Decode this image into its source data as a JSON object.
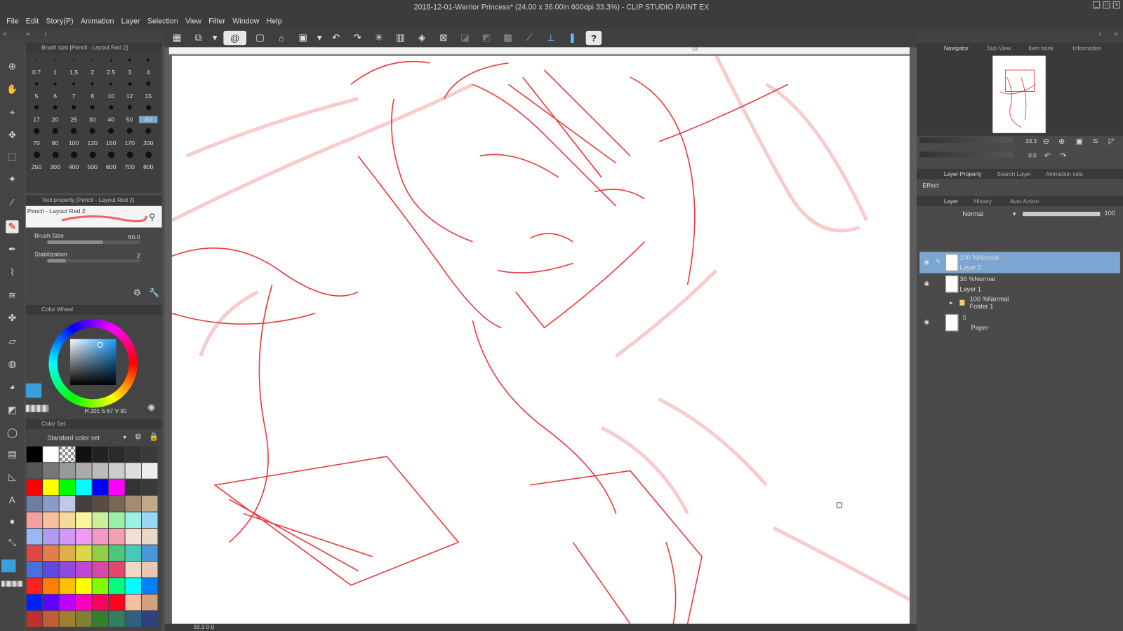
{
  "window": {
    "title": "2018-12-01-Warrior Princess* (24.00 x 36.00in 600dpi 33.3%) - CLIP STUDIO PAINT EX"
  },
  "menu": [
    "File",
    "Edit",
    "Story(P)",
    "Animation",
    "Layer",
    "Selection",
    "View",
    "Filter",
    "Window",
    "Help"
  ],
  "toolbar": {
    "icons": [
      "grid-icon",
      "sub-view-icon",
      "lasso-icon",
      "new-icon",
      "open-icon",
      "save-icon",
      "undo-icon",
      "redo-icon",
      "transform-icon",
      "help-icon"
    ]
  },
  "brush_panel": {
    "title": "Brush size [Pencil - Layout Red 2]",
    "sizes": [
      "0.7",
      "1",
      "1.5",
      "2",
      "2.5",
      "3",
      "4",
      "5",
      "6",
      "7",
      "8",
      "10",
      "12",
      "15",
      "17",
      "20",
      "25",
      "30",
      "40",
      "50",
      "60",
      "70",
      "80",
      "100",
      "120",
      "150",
      "170",
      "200",
      "250",
      "300",
      "400",
      "500",
      "600",
      "700",
      "800"
    ],
    "selected_size": "60"
  },
  "tool_property": {
    "title": "Tool property [Pencil - Layout Red 2]",
    "preset": "Pencil - Layout Red 2",
    "brush_size_label": "Brush Size",
    "brush_size_value": "60.0",
    "brush_size_level": 0.6,
    "stabilization_label": "Stabilization",
    "stabilization_value": "2",
    "stabilization_level": 0.2
  },
  "color_wheel": {
    "title": "Color Wheel",
    "h": "201",
    "s": "67",
    "v": "90",
    "h_label": "H",
    "s_label": "S",
    "v_label": "V",
    "current_color": "#3aa0dd"
  },
  "color_set": {
    "title": "Color Set",
    "set_name": "Standard color set",
    "swatches": [
      [
        "#000000",
        "#ffffff",
        "checker",
        "#111111",
        "#222222",
        "#2a2a2a",
        "#333333",
        "#3a3a3a"
      ],
      [
        "#555555",
        "#777777",
        "#999999",
        "#aaaaaa",
        "#bbbbbb",
        "#cccccc",
        "#dddddd",
        "#eeeeee"
      ],
      [
        "#ff0000",
        "#ffff00",
        "#00ff00",
        "#00ffff",
        "#0000ff",
        "#ff00ff",
        "#333333",
        "#3a3a3a"
      ],
      [
        "#6b7fa6",
        "#8b9cc9",
        "#bfc8e6",
        "#443f3a",
        "#5a4c42",
        "#7a6652",
        "#a58b72",
        "#c2a98c"
      ],
      [
        "#f4a0a0",
        "#f7c29a",
        "#f6da9a",
        "#f7f79a",
        "#c8f19a",
        "#9af0a8",
        "#9af0e2",
        "#9ad6f7"
      ],
      [
        "#9ab8f4",
        "#b09af4",
        "#d09af4",
        "#f09af0",
        "#f49ac4",
        "#f4a0b0",
        "#f2e0d8",
        "#e8d8c8"
      ],
      [
        "#e04848",
        "#e08048",
        "#e0b048",
        "#d8d848",
        "#90d048",
        "#48c878",
        "#48c8b8",
        "#4898d8"
      ],
      [
        "#4870e0",
        "#6048e0",
        "#9048e0",
        "#c048d8",
        "#d848a8",
        "#e04870",
        "#f0d8c8",
        "#e8c8b0"
      ],
      [
        "#ff2020",
        "#ff8000",
        "#ffc000",
        "#ffff00",
        "#80ff00",
        "#00ff80",
        "#00ffff",
        "#0080ff"
      ],
      [
        "#0020ff",
        "#6000ff",
        "#c000ff",
        "#ff00c0",
        "#ff0060",
        "#ff0020",
        "#f0c0a0",
        "#d0a080"
      ],
      [
        "#c03030",
        "#c06030",
        "#a08030",
        "#808030",
        "#308030",
        "#308060",
        "#306080",
        "#304080"
      ]
    ]
  },
  "right_panels": {
    "nav_tabs": [
      "Navigator",
      "Sub View",
      "Item bank",
      "Information"
    ],
    "zoom": "33.3",
    "rotation": "0.0",
    "layer_prop_tabs": [
      "Layer Property",
      "Search Layer",
      "Animation cels"
    ],
    "effect_label": "Effect",
    "layer_tabs": [
      "Layer",
      "History",
      "Auto Action"
    ],
    "blend_mode": "Normal",
    "opacity": "100",
    "layers": [
      {
        "mode": "100 %Normal",
        "name": "Layer 2",
        "selected": true
      },
      {
        "mode": "36 %Normal",
        "name": "Layer 1",
        "selected": false
      },
      {
        "mode": "100 %Normal",
        "name": "Folder 1",
        "selected": false
      },
      {
        "mode": "",
        "name": "Paper",
        "selected": false
      }
    ]
  },
  "status": {
    "zoom": "33.3",
    "angle": "0.0"
  },
  "ruler_mark": "10",
  "sketch_color": "#e8262a"
}
